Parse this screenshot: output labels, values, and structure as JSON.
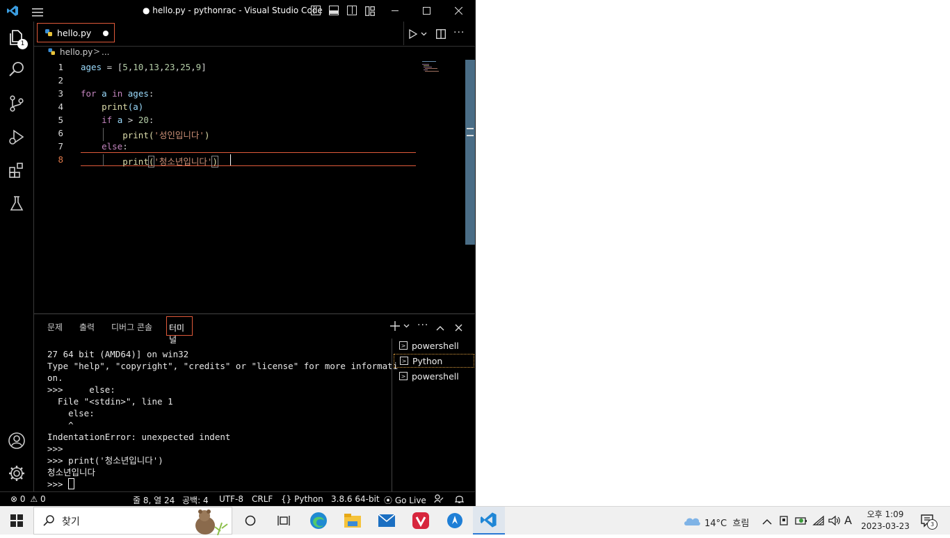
{
  "window": {
    "title": "● hello.py - pythonrac - Visual Studio Code"
  },
  "activity": {
    "explorer_badge": "1"
  },
  "tab": {
    "label": "hello.py"
  },
  "breadcrumb": {
    "file": "hello.py",
    "sep": ">",
    "rest": "..."
  },
  "editor": {
    "line_numbers": [
      "1",
      "2",
      "3",
      "4",
      "5",
      "6",
      "7",
      "8"
    ],
    "line1": {
      "var": "ages",
      "eq": " = ",
      "lb": "[",
      "n1": "5",
      "n2": "10",
      "n3": "13",
      "n4": "23",
      "n5": "25",
      "n6": "9",
      "rb": "]",
      "comma": ","
    },
    "line3": {
      "kw1": "for",
      "v1": "a",
      "kw2": "in",
      "v2": "ages",
      "colon": ":"
    },
    "line4": {
      "fn": "print",
      "args": "(a)"
    },
    "line5": {
      "kw": "if",
      "v": "a",
      "op": " > ",
      "num": "20",
      "colon": ":"
    },
    "line6": {
      "fn": "print",
      "lp": "(",
      "str": "'성인입니다'",
      "rp": ")"
    },
    "line7": {
      "kw": "else",
      "colon": ":"
    },
    "line8": {
      "fn": "print",
      "lp": "(",
      "str": "'청소년입니다'",
      "rp": ")"
    }
  },
  "panel": {
    "tabs": [
      "문제",
      "출력",
      "디버그 콘솔",
      "터미널"
    ],
    "terminal_lines": [
      "27 64 bit (AMD64)] on win32",
      "Type \"help\", \"copyright\", \"credits\" or \"license\" for more informati",
      "on.",
      ">>>     else:",
      "  File \"<stdin>\", line 1",
      "    else:",
      "    ^",
      "IndentationError: unexpected indent",
      ">>>",
      ">>> print('청소년입니다')",
      "청소년입니다",
      ">>> "
    ],
    "terminals": [
      "powershell",
      "Python",
      "powershell"
    ]
  },
  "statusbar": {
    "errors": "0",
    "warnings": "0",
    "position": "줄 8, 열 24",
    "spaces": "공백: 4",
    "encoding": "UTF-8",
    "eol": "CRLF",
    "language": "Python",
    "interpreter": "3.8.6 64-bit",
    "golive": "Go Live"
  },
  "taskbar": {
    "search_label": "찾기",
    "weather": "14°C  흐림",
    "ime": "A",
    "time": "오후 1:09",
    "date": "2023-03-23",
    "notifications": "3"
  },
  "colors": {
    "accent_border": "#e05a3a",
    "keyword": "#c586c0",
    "number": "#b5cea8",
    "string": "#ce9178",
    "function": "#dcdcaa",
    "variable": "#9cdcfe"
  }
}
